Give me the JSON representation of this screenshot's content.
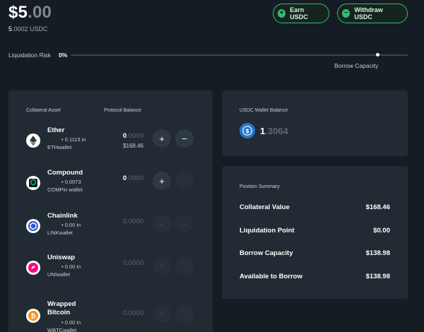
{
  "header": {
    "balance_main_whole": "$5",
    "balance_main_decimal": ".00",
    "balance_sub_bright": "5",
    "balance_sub_rest": ".0002 USDC",
    "earn_label": "Earn USDC",
    "withdraw_label": "Withdraw USDC"
  },
  "liquidation": {
    "label": "Liquidation Risk",
    "value": "0%",
    "capacity_label": "Borrow Capacity",
    "risk_fraction": 0.0
  },
  "collateral": {
    "col_asset": "Collateral Asset",
    "col_balance": "Protocol Balance",
    "assets": [
      {
        "name": "Ether",
        "name2": "",
        "amount": "• 0.1113 in",
        "wallet": "ETHwallet",
        "bal_bright": "0",
        "bal_rest": ".0000",
        "usd": "$168.46",
        "enabled": true,
        "can_withdraw": true,
        "icon": "ether-icon"
      },
      {
        "name": "Compound",
        "name2": "",
        "amount": "• 0.0073",
        "wallet": "COMPin wallet",
        "bal_bright": "0",
        "bal_rest": ".0000",
        "usd": "",
        "enabled": true,
        "can_withdraw": false,
        "icon": "compound-icon"
      },
      {
        "name": "Chainlink",
        "name2": "",
        "amount": "• 0.00 in",
        "wallet": "LINKwallet",
        "bal_bright": "",
        "bal_rest": "0.0000",
        "usd": "",
        "enabled": false,
        "can_withdraw": false,
        "icon": "chainlink-icon"
      },
      {
        "name": "Uniswap",
        "name2": "",
        "amount": "• 0.00 in",
        "wallet": "UNIwallet",
        "bal_bright": "",
        "bal_rest": "0.0000",
        "usd": "",
        "enabled": false,
        "can_withdraw": false,
        "icon": "uniswap-icon"
      },
      {
        "name": "Wrapped",
        "name2": "Bitcoin",
        "amount": "• 0.00 in",
        "wallet": "WBTCwallet",
        "bal_bright": "",
        "bal_rest": "0.0000",
        "usd": "",
        "enabled": false,
        "can_withdraw": false,
        "icon": "bitcoin-icon"
      }
    ]
  },
  "wallet": {
    "label": "USDC Wallet Balance",
    "value_bright": "1",
    "value_rest": ".3064"
  },
  "summary": {
    "label": "Position Summary",
    "rows": [
      {
        "label": "Collateral Value",
        "value": "$168.46"
      },
      {
        "label": "Liquidation Point",
        "value": "$0.00"
      },
      {
        "label": "Borrow Capacity",
        "value": "$138.98"
      },
      {
        "label": "Available to Borrow",
        "value": "$138.98"
      }
    ]
  },
  "colors": {
    "accent": "#2fbf71",
    "card": "#222b34",
    "bg": "#151c23",
    "usdc": "#2775ca"
  }
}
